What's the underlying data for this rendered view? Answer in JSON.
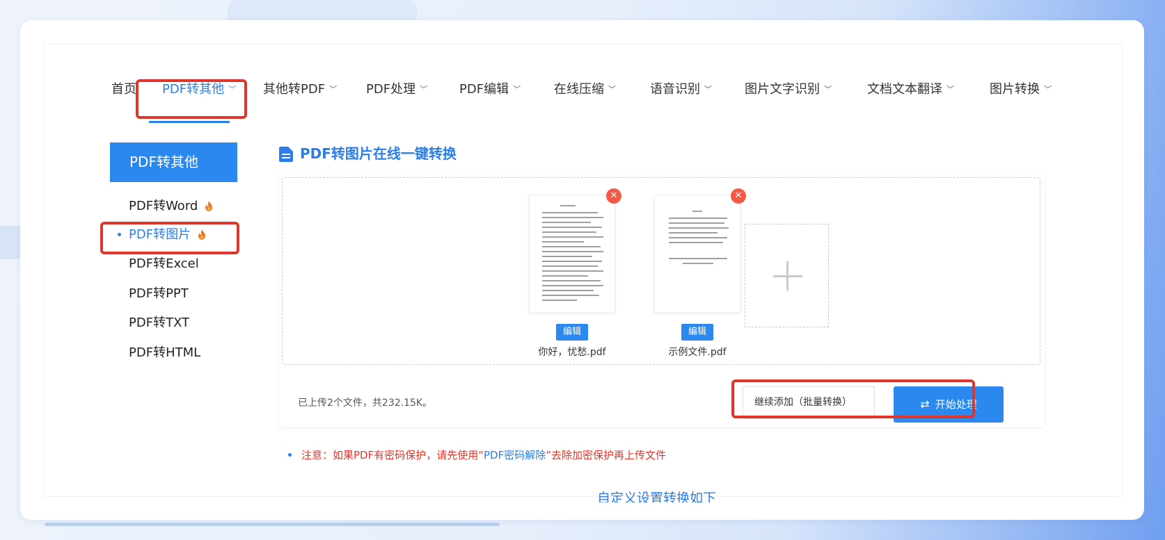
{
  "nav": {
    "items": [
      {
        "label": "首页",
        "dropdown": false
      },
      {
        "label": "PDF转其他",
        "dropdown": true,
        "active": true
      },
      {
        "label": "其他转PDF",
        "dropdown": true
      },
      {
        "label": "PDF处理",
        "dropdown": true
      },
      {
        "label": "PDF编辑",
        "dropdown": true
      },
      {
        "label": "在线压缩",
        "dropdown": true
      },
      {
        "label": "语音识别",
        "dropdown": true
      },
      {
        "label": "图片文字识别",
        "dropdown": true
      },
      {
        "label": "文档文本翻译",
        "dropdown": true
      },
      {
        "label": "图片转换",
        "dropdown": true
      }
    ],
    "chevron_icon": "chevron-down-icon"
  },
  "sidebar": {
    "header": "PDF转其他",
    "items": [
      {
        "label": "PDF转Word",
        "hot": true
      },
      {
        "label": "PDF转图片",
        "hot": true,
        "active": true
      },
      {
        "label": "PDF转Excel",
        "hot": false
      },
      {
        "label": "PDF转PPT",
        "hot": false
      },
      {
        "label": "PDF转TXT",
        "hot": false
      },
      {
        "label": "PDF转HTML",
        "hot": false
      }
    ]
  },
  "main": {
    "title": "PDF转图片在线一键转换",
    "files": [
      {
        "name": "你好，忧愁.pdf",
        "edit_label": "编辑"
      },
      {
        "name": "示例文件.pdf",
        "edit_label": "编辑"
      }
    ],
    "remove_glyph": "✕",
    "add_icon": "plus-icon",
    "status": "已上传2个文件，共232.15K。",
    "continue_label": "继续添加（批量转换）",
    "start_label": "开始处理",
    "notice_prefix": "注意：如果PDF有密码保护，请先使用“",
    "notice_link": "PDF密码解除",
    "notice_suffix": "”去除加密保护再上传文件",
    "custom_settings": "自定义设置转换如下"
  },
  "colors": {
    "accent": "#2b7de9",
    "highlight_box": "#e0352b",
    "remove": "#f25a48"
  }
}
